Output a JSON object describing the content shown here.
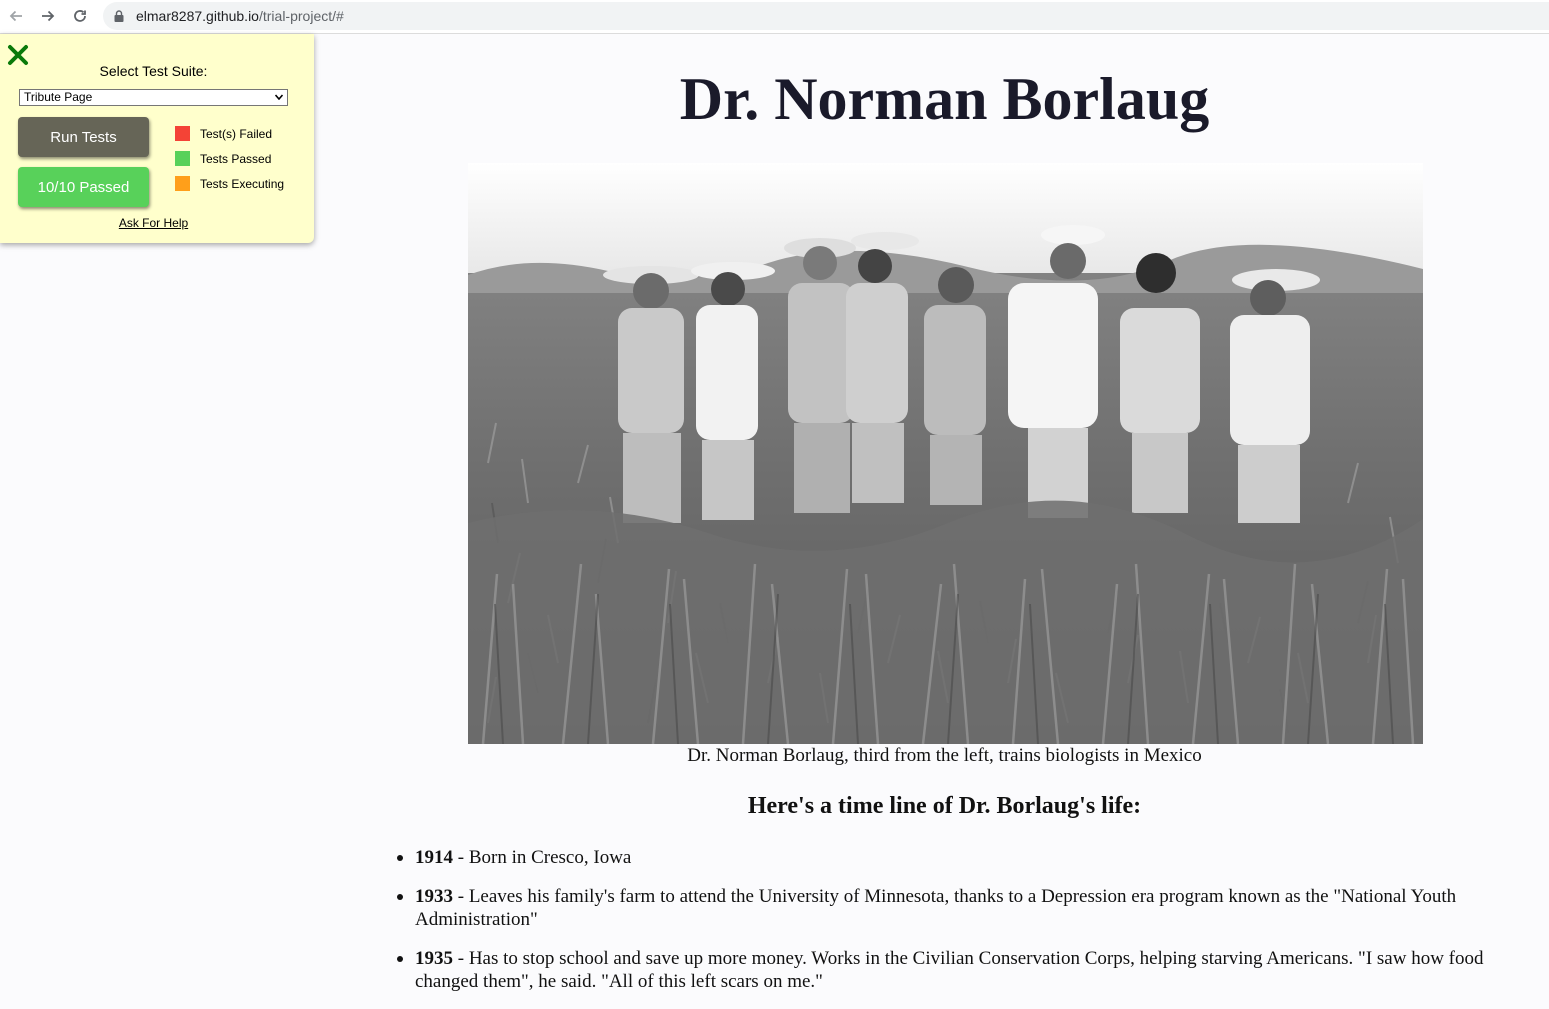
{
  "browser": {
    "url_host": "elmar8287.github.io",
    "url_path": "/trial-project/#"
  },
  "test_panel": {
    "select_label": "Select Test Suite:",
    "selected_suite": "Tribute Page",
    "run_button": "Run Tests",
    "result_button": "10/10 Passed",
    "legend": [
      {
        "label": "Test(s) Failed",
        "color": "#f44336"
      },
      {
        "label": "Tests Passed",
        "color": "#58d15a"
      },
      {
        "label": "Tests Executing",
        "color": "#ff9f1a"
      }
    ],
    "help_link": "Ask For Help"
  },
  "page": {
    "title": "Dr. Norman Borlaug",
    "image_caption": "Dr. Norman Borlaug, third from the left, trains biologists in Mexico",
    "timeline_heading": "Here's a time line of Dr. Borlaug's life:",
    "timeline": [
      {
        "year": "1914",
        "text": " - Born in Cresco, Iowa"
      },
      {
        "year": "1933",
        "text": " - Leaves his family's farm to attend the University of Minnesota, thanks to a Depression era program known as the \"National Youth Administration\""
      },
      {
        "year": "1935",
        "text": " - Has to stop school and save up more money. Works in the Civilian Conservation Corps, helping starving Americans. \"I saw how food changed them\", he said. \"All of this left scars on me.\""
      }
    ]
  }
}
